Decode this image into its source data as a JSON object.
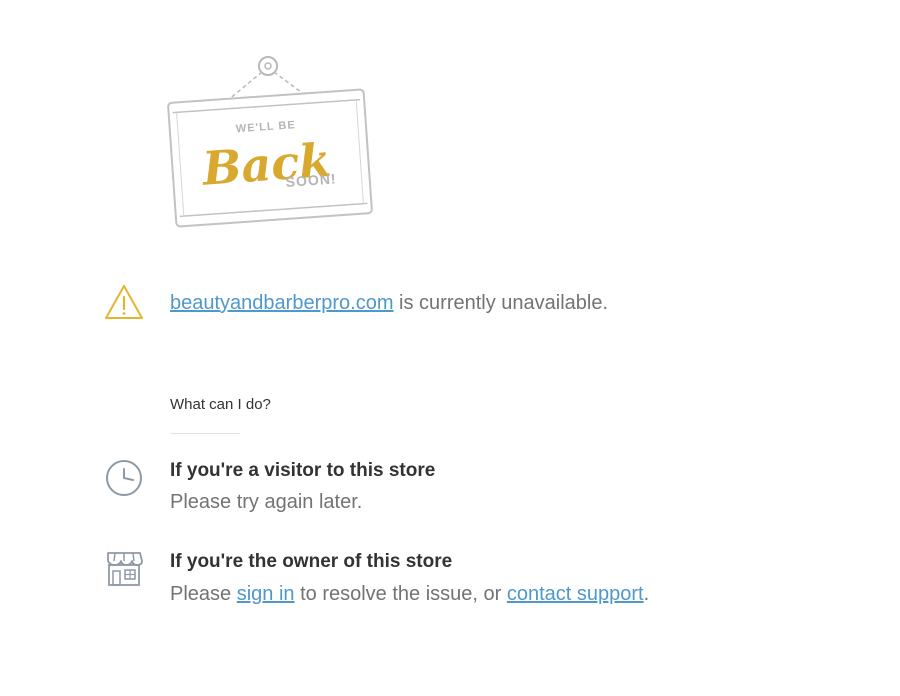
{
  "sign": {
    "line1": "WE'LL BE",
    "line2": "Back",
    "line3": "SOON!"
  },
  "notice": {
    "domain": "beautyandbarberpro.com",
    "message": " is currently unavailable."
  },
  "help": {
    "heading": "What can I do?",
    "visitor": {
      "title": "If you're a visitor to this store",
      "text": "Please try again later."
    },
    "owner": {
      "title": "If you're the owner of this store",
      "text_before": "Please ",
      "sign_in": "sign in",
      "text_middle": " to resolve the issue, or ",
      "contact": "contact support",
      "text_after": "."
    }
  },
  "colors": {
    "accent_gold": "#d9a82e",
    "link_blue": "#4f98cc",
    "sign_gray": "#b9b9b9",
    "icon_gray": "#8f99a5"
  },
  "icons": [
    "warning-icon",
    "clock-icon",
    "storefront-icon"
  ]
}
